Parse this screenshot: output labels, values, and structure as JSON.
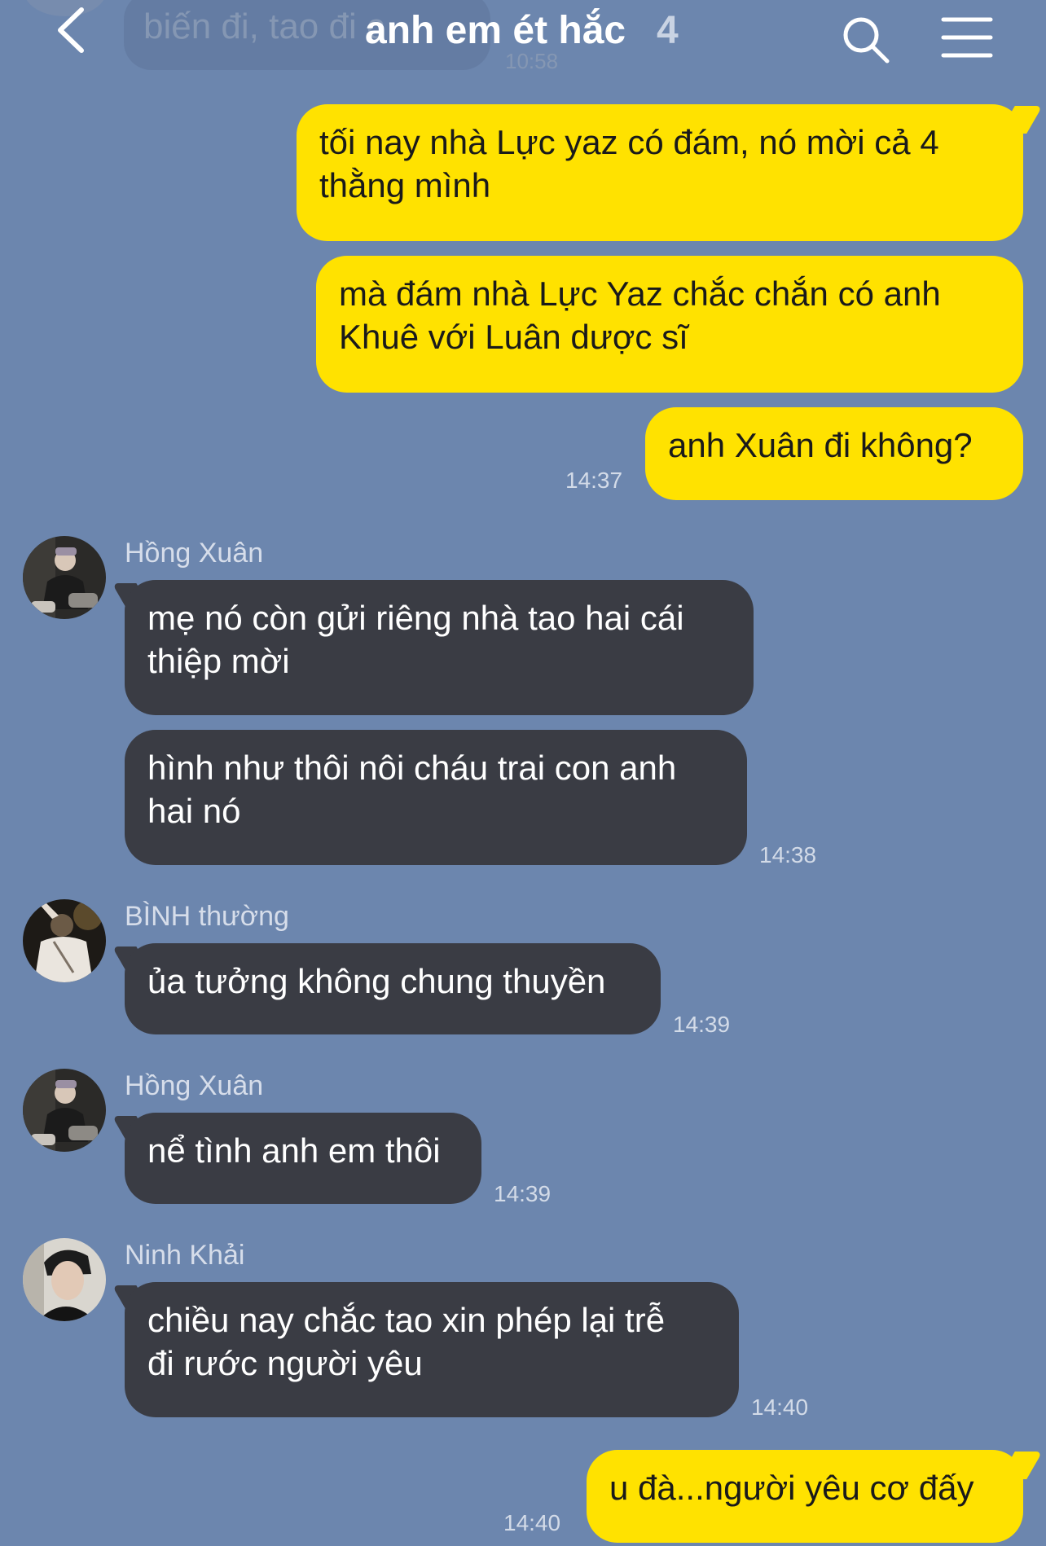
{
  "header": {
    "title": "anh em ét hắc",
    "member_count": "4",
    "back_icon": "chevron-left-icon",
    "search_icon": "search-icon",
    "menu_icon": "hamburger-menu-icon"
  },
  "previous_message": {
    "text": "biến đi, tao đi c",
    "time": "10:58"
  },
  "messages": [
    {
      "id": "m1",
      "direction": "out",
      "lines": [
        "tối nay nhà Lực yaz có đám, nó mời cả 4",
        "thằng mình"
      ]
    },
    {
      "id": "m2",
      "direction": "out",
      "lines": [
        "mà đám nhà Lực Yaz chắc chắn có anh",
        "Khuê với Luân dược sĩ"
      ]
    },
    {
      "id": "m3",
      "direction": "out",
      "lines": [
        "anh Xuân đi không?"
      ],
      "time": "14:37"
    },
    {
      "id": "m4",
      "direction": "in",
      "sender": "Hồng Xuân",
      "lines": [
        "mẹ nó còn gửi riêng nhà tao hai cái",
        "thiệp mời"
      ]
    },
    {
      "id": "m5",
      "direction": "in",
      "lines": [
        "hình như thôi nôi cháu trai con anh",
        "hai nó"
      ],
      "time": "14:38"
    },
    {
      "id": "m6",
      "direction": "in",
      "sender": "BÌNH thường",
      "lines": [
        "ủa tưởng không chung thuyền"
      ],
      "time": "14:39"
    },
    {
      "id": "m7",
      "direction": "in",
      "sender": "Hồng Xuân",
      "lines": [
        "nể tình anh em thôi"
      ],
      "time": "14:39"
    },
    {
      "id": "m8",
      "direction": "in",
      "sender": "Ninh Khải",
      "lines": [
        "chiều nay chắc tao xin phép lại trễ",
        "đi rước người yêu"
      ],
      "time": "14:40"
    },
    {
      "id": "m9",
      "direction": "out",
      "lines": [
        "u đà...người yêu cơ đấy"
      ],
      "time": "14:40"
    }
  ],
  "colors": {
    "background": "#6c86ae",
    "outgoing_bubble": "#ffe200",
    "incoming_bubble": "#3a3c44",
    "timestamp": "#d3dbe8"
  }
}
